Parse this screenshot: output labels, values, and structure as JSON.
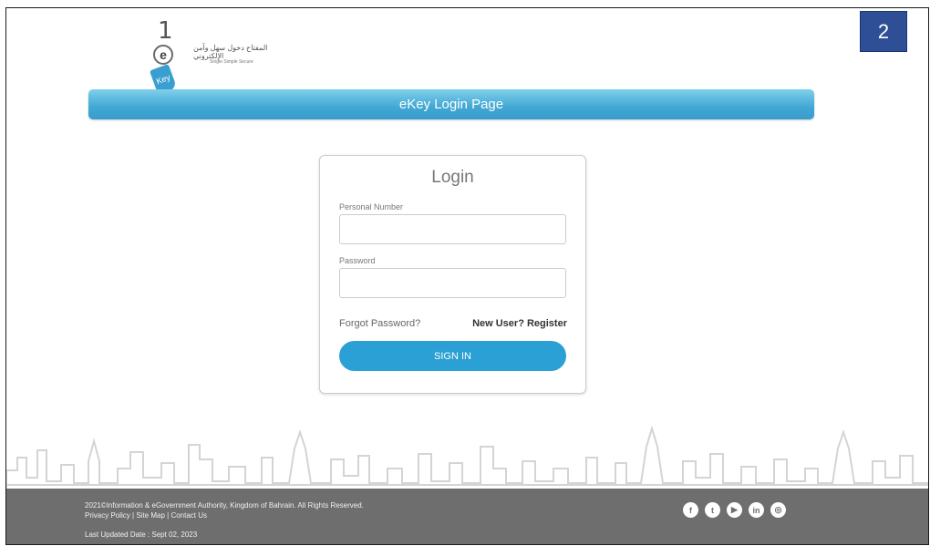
{
  "slide_number": "2",
  "logo": {
    "digit": "1",
    "e_letter": "e",
    "tag_text": "Key",
    "arabic_line1": "المفتاح    دخول سهل وآمن",
    "arabic_line2": "الإلكتروني",
    "english_tagline": "Single Simple Secure"
  },
  "banner": {
    "title": "eKey Login Page"
  },
  "login": {
    "heading": "Login",
    "personal_number_label": "Personal Number",
    "personal_number_value": "",
    "password_label": "Password",
    "password_value": "",
    "forgot_password": "Forgot Password?",
    "register": "New User? Register",
    "sign_in": "SIGN IN"
  },
  "footer": {
    "copyright": "2021©Information & eGovernment Authority, Kingdom of Bahrain. All Rights Reserved.",
    "links": [
      "Privacy Policy",
      "Site Map",
      "Contact Us"
    ],
    "separator": " | ",
    "last_updated": "Last Updated Date : Sept 02, 2023",
    "socials": [
      {
        "icon": "facebook-icon",
        "glyph": "f"
      },
      {
        "icon": "twitter-icon",
        "glyph": "t"
      },
      {
        "icon": "youtube-icon",
        "glyph": "▶"
      },
      {
        "icon": "linkedin-icon",
        "glyph": "in"
      },
      {
        "icon": "instagram-icon",
        "glyph": "◎"
      }
    ]
  },
  "colors": {
    "banner": "#41a7d3",
    "button": "#2aa0d4",
    "footer": "#6e6e6e",
    "slide_badge": "#2e4f95"
  }
}
